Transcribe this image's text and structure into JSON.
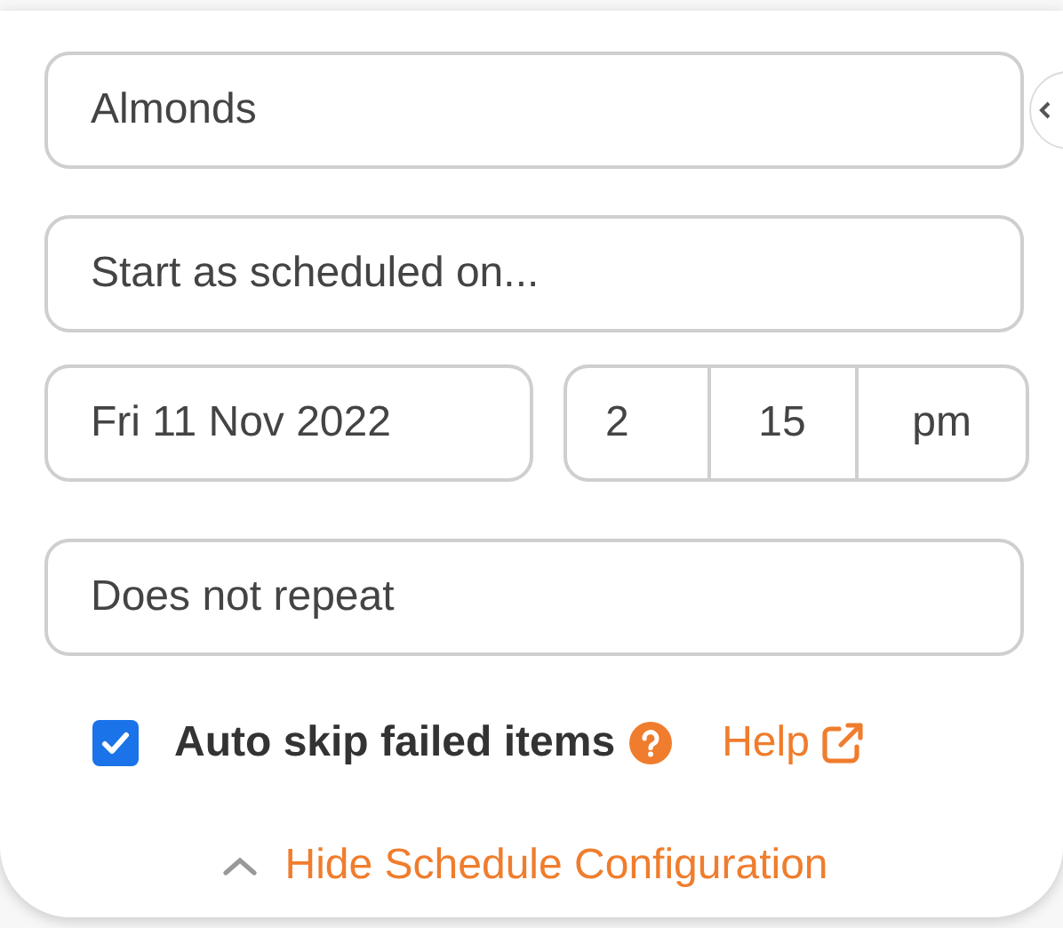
{
  "recipe_field": {
    "value": "Almonds"
  },
  "start_field": {
    "value": "Start as scheduled on..."
  },
  "date_field": {
    "value": "Fri 11 Nov 2022"
  },
  "time": {
    "hour": "2",
    "minute": "15",
    "period": "pm"
  },
  "repeat_field": {
    "value": "Does not repeat"
  },
  "auto_skip": {
    "label": "Auto skip failed items",
    "checked": true
  },
  "help_link": {
    "label": "Help"
  },
  "toggle_link": {
    "label": "Hide Schedule Configuration",
    "expanded": true
  }
}
